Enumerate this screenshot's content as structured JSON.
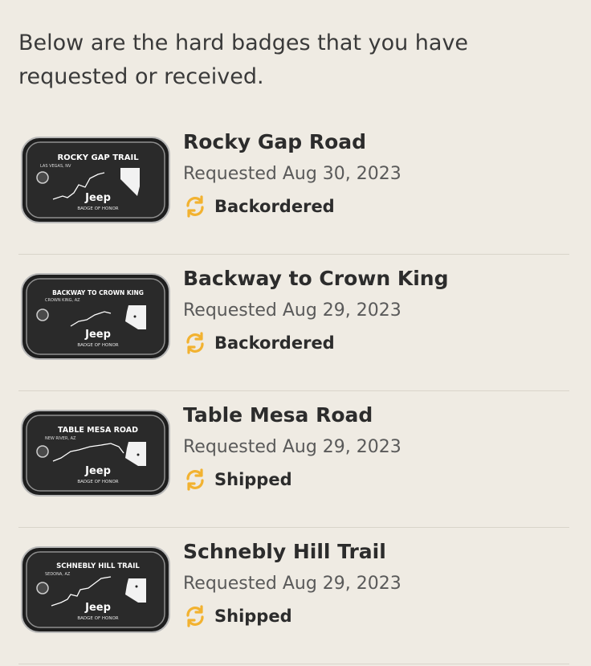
{
  "intro": "Below are the hard badges that you have requested or received.",
  "accent_color": "#f2b230",
  "badges": [
    {
      "name": "Rocky Gap Road",
      "date": "Requested Aug 30, 2023",
      "status": "Backordered",
      "status_icon": "refresh-icon",
      "plate_title": "ROCKY GAP TRAIL",
      "plate_location": "LAS VEGAS, NV",
      "plate_brand": "Jeep",
      "plate_footer": "BADGE OF HONOR",
      "state_icon": "nevada-map-icon"
    },
    {
      "name": "Backway to Crown King",
      "date": "Requested Aug 29, 2023",
      "status": "Backordered",
      "status_icon": "refresh-icon",
      "plate_title": "BACKWAY TO CROWN KING",
      "plate_location": "CROWN KING, AZ",
      "plate_brand": "Jeep",
      "plate_footer": "BADGE OF HONOR",
      "state_icon": "arizona-map-icon"
    },
    {
      "name": "Table Mesa Road",
      "date": "Requested Aug 29, 2023",
      "status": "Shipped",
      "status_icon": "refresh-icon",
      "plate_title": "TABLE MESA ROAD",
      "plate_location": "NEW RIVER, AZ",
      "plate_brand": "Jeep",
      "plate_footer": "BADGE OF HONOR",
      "state_icon": "arizona-map-icon"
    },
    {
      "name": "Schnebly Hill Trail",
      "date": "Requested Aug 29, 2023",
      "status": "Shipped",
      "status_icon": "refresh-icon",
      "plate_title": "SCHNEBLY HILL TRAIL",
      "plate_location": "SEDONA, AZ",
      "plate_brand": "Jeep",
      "plate_footer": "BADGE OF HONOR",
      "state_icon": "arizona-map-icon"
    }
  ]
}
